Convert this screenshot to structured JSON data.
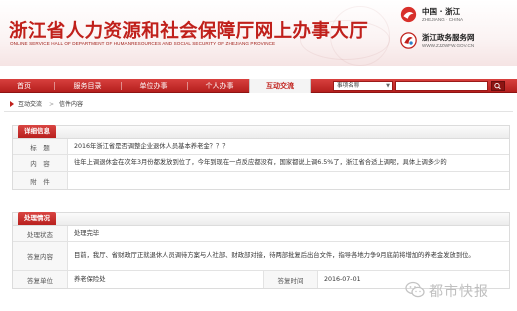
{
  "header": {
    "title": "浙江省人力资源和社会保障厅网上办事大厅",
    "subtitle": "ONLINE SERVICE HALL OF DEPARTMENT OF HUMANRESOURCES AND SOCIAL SECURITY OF ZHEJIANG PROVINCE",
    "brand1": {
      "name": "中国 · 浙江",
      "sub": "ZHEJIANG · CHINA"
    },
    "brand2": {
      "name": "浙江政务服务网",
      "sub": "WWW.ZJZWFW.GOV.CN"
    }
  },
  "nav": {
    "items": [
      "首页",
      "服务目录",
      "单位办事",
      "个人办事",
      "互动交流"
    ],
    "active_index": 4,
    "search_category": "事项名称"
  },
  "breadcrumb": {
    "link": "互动交流",
    "separator": ">",
    "current": "信件内容"
  },
  "details": {
    "section_title": "详细信息",
    "rows": [
      {
        "label": "标　题",
        "value": "2016年浙江省是否调整企业退休人员基本养老金？？？"
      },
      {
        "label": "内　容",
        "value": "往年上调退休金在次年3月份都发放到位了，今年到现在一点反应都没有，国家都说上调6.5%了，浙江省合适上调呢，具体上调多少的"
      },
      {
        "label": "附　件",
        "value": ""
      }
    ]
  },
  "handling": {
    "section_title": "处理情况",
    "status_label": "处理状态",
    "status_value": "处理完毕",
    "content_label": "答复内容",
    "content_value": "目前，我厅、省财政厅正就退休人员调待方案与人社部、财政部对接，待两部批复后出台文件，指导各地力争9月底前将增加的养老金发放到位。",
    "unit_label": "答复单位",
    "unit_value": "养老保险处",
    "time_label": "答复时间",
    "time_value": "2016-07-01"
  },
  "watermark": {
    "text": "都市快报"
  },
  "colors": {
    "brand_red": "#c0201b",
    "nav_red": "#b51f1d"
  }
}
